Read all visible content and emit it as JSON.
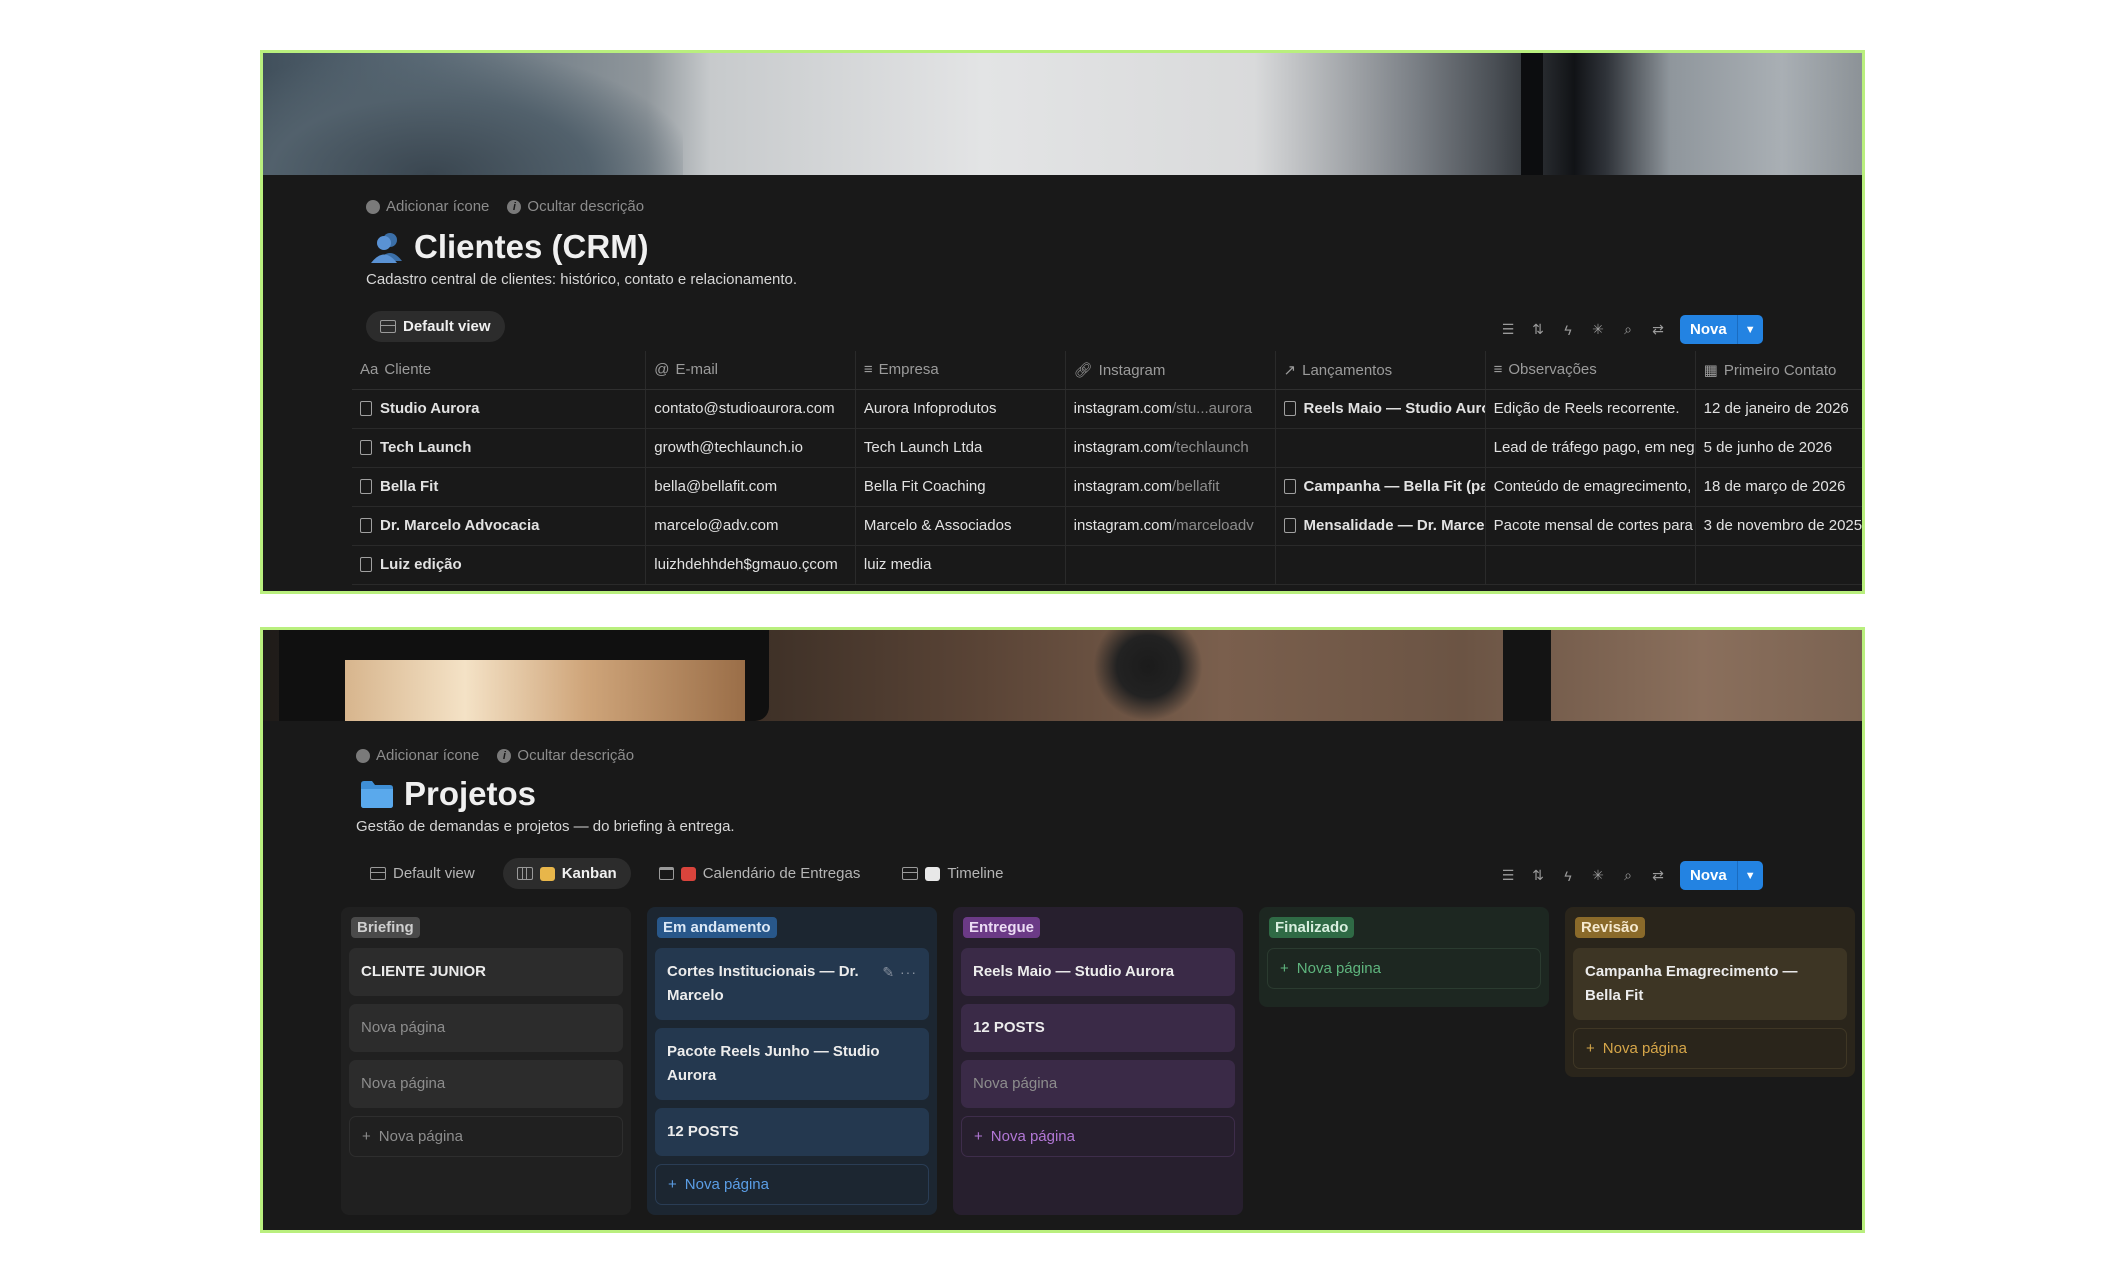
{
  "crm": {
    "add_icon": "Adicionar ícone",
    "hide_description": "Ocultar descrição",
    "title": "Clientes (CRM)",
    "description": "Cadastro central de clientes: histórico, contato e relacionamento.",
    "view_tab": "Default view",
    "new_button": "Nova",
    "columns": [
      "Cliente",
      "E-mail",
      "Empresa",
      "Instagram",
      "Lançamentos",
      "Observações",
      "Primeiro Contato"
    ],
    "rows": [
      {
        "cliente": "Studio Aurora",
        "email": "contato@studioaurora.com",
        "empresa": "Aurora Infoprodutos",
        "ig_domain": "instagram.com",
        "ig_path": "/stu...aurora",
        "lancamento": "Reels Maio — Studio Aurora",
        "obs": "Edição de Reels recorrente.",
        "contato": "12 de janeiro de 2026"
      },
      {
        "cliente": "Tech Launch",
        "email": "growth@techlaunch.io",
        "empresa": "Tech Launch Ltda",
        "ig_domain": "instagram.com",
        "ig_path": "/techlaunch",
        "lancamento": "",
        "obs": "Lead de tráfego pago, em negociação",
        "contato": "5 de junho de 2026"
      },
      {
        "cliente": "Bella Fit",
        "email": "bella@bellafit.com",
        "empresa": "Bella Fit Coaching",
        "ig_domain": "instagram.com",
        "ig_path": "/bellafit",
        "lancamento": "Campanha — Bella Fit (parceria)",
        "obs": "Conteúdo de emagrecimento, foco",
        "contato": "18 de março de 2026"
      },
      {
        "cliente": "Dr. Marcelo Advocacia",
        "email": "marcelo@adv.com",
        "empresa": "Marcelo & Associados",
        "ig_domain": "instagram.com",
        "ig_path": "/marceloadv",
        "lancamento": "Mensalidade — Dr. Marcelo",
        "obs": "Pacote mensal de cortes para Instagram",
        "contato": "3 de novembro de 2025"
      },
      {
        "cliente": "Luiz edição",
        "email": "luizhdehhdeh$gmauo.çcom",
        "empresa": "luiz media",
        "ig_domain": "",
        "ig_path": "",
        "lancamento": "",
        "obs": "",
        "contato": ""
      }
    ]
  },
  "projetos": {
    "add_icon": "Adicionar ícone",
    "hide_description": "Ocultar descrição",
    "title": "Projetos",
    "description": "Gestão de demandas e projetos — do briefing à entrega.",
    "tabs": [
      "Default view",
      "Kanban",
      "Calendário de Entregas",
      "Timeline"
    ],
    "new_button": "Nova",
    "new_page": "Nova página",
    "columns": [
      {
        "name": "Briefing",
        "cards": [
          "CLIENTE JUNIOR",
          "Nova página",
          "Nova página"
        ],
        "add": "Nova página"
      },
      {
        "name": "Em andamento",
        "cards": [
          "Cortes Institucionais — Dr. Marcelo",
          "Pacote Reels Junho — Studio Aurora",
          "12 POSTS"
        ],
        "add": "Nova página"
      },
      {
        "name": "Entregue",
        "cards": [
          "Reels Maio — Studio Aurora",
          "12 POSTS",
          "Nova página"
        ],
        "add": "Nova página"
      },
      {
        "name": "Finalizado",
        "cards": [],
        "add": "Nova página"
      },
      {
        "name": "Revisão",
        "cards": [
          "Campanha Emagrecimento — Bella Fit"
        ],
        "add": "Nova página"
      }
    ]
  },
  "colors": {
    "accent": "#2383e2",
    "panel_bg": "#191919",
    "border": "#b9ef7e"
  }
}
